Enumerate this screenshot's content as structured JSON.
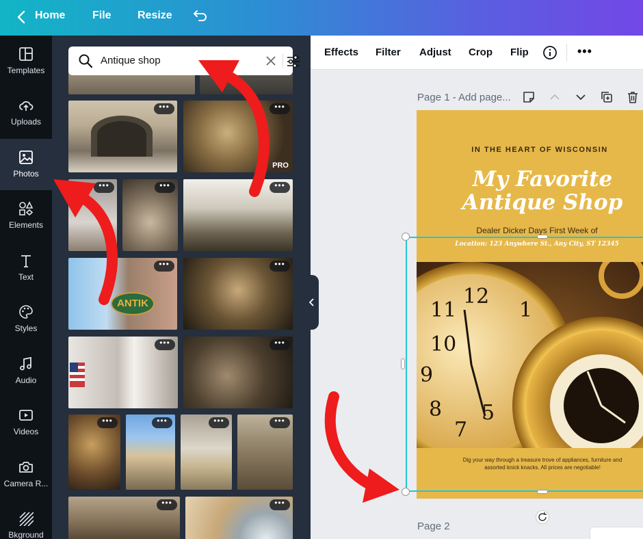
{
  "topbar": {
    "home_label": "Home",
    "file_label": "File",
    "resize_label": "Resize"
  },
  "sidebar": {
    "items": [
      {
        "label": "Templates",
        "icon": "templates-icon"
      },
      {
        "label": "Uploads",
        "icon": "cloud-upload-icon"
      },
      {
        "label": "Photos",
        "icon": "photo-icon"
      },
      {
        "label": "Elements",
        "icon": "shapes-icon"
      },
      {
        "label": "Text",
        "icon": "text-icon"
      },
      {
        "label": "Styles",
        "icon": "palette-icon"
      },
      {
        "label": "Audio",
        "icon": "music-note-icon"
      },
      {
        "label": "Videos",
        "icon": "video-icon"
      },
      {
        "label": "Camera R...",
        "icon": "camera-icon"
      },
      {
        "label": "Bkground",
        "icon": "stripes-icon"
      }
    ],
    "active": "Photos"
  },
  "search": {
    "value": "Antique shop"
  },
  "photos": {
    "pro_badge": "PRO",
    "sign_text": "ANTIK",
    "more_label": "•••"
  },
  "toolbar": {
    "effects": "Effects",
    "filter": "Filter",
    "adjust": "Adjust",
    "crop": "Crop",
    "flip": "Flip",
    "more": "•••"
  },
  "canvas": {
    "page1_label": "Page 1 - Add page...",
    "page2_label": "Page 2"
  },
  "design": {
    "eyebrow": "IN THE HEART OF WISCONSIN",
    "title_line1": "My Favorite",
    "title_line2": "Antique Shop",
    "subtitle": "Dealer Dicker Days First Week of",
    "location": "Location: 123 Anywhere St., Any City, ST 12345",
    "body": "Dig your way through a treasure trove of appliances, furniture and assorted knick knacks. All prices are negotiable!"
  },
  "colors": {
    "accent_cyan": "#22c7d6",
    "design_bg": "#e6b84a",
    "arrow_red": "#ee1c1c",
    "sidebar_bg": "#0e1318",
    "panel_bg": "#252f3d"
  }
}
